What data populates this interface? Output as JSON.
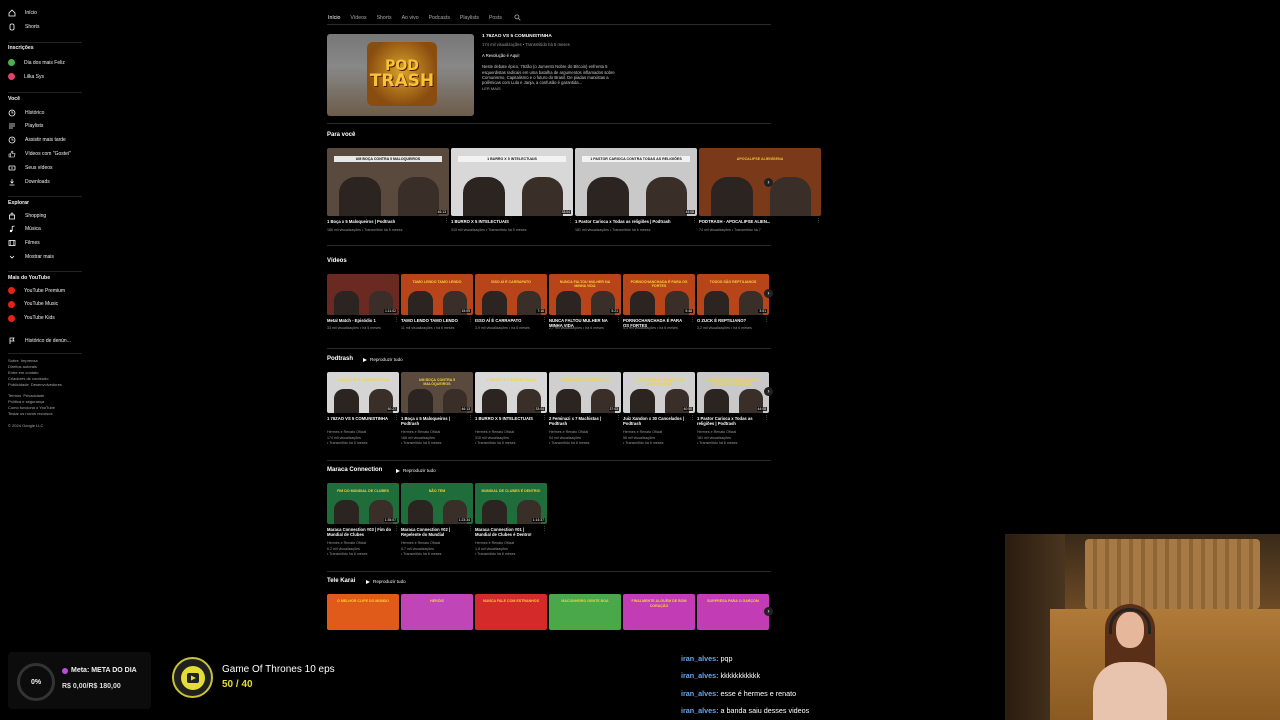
{
  "sidebar": {
    "top": [
      {
        "label": "Início",
        "icon": "home-icon"
      },
      {
        "label": "Shorts",
        "icon": "shorts-icon"
      }
    ],
    "subscriptions_label": "Inscrições",
    "subscriptions": [
      {
        "label": "Dia dos mais Feliz",
        "color": "#4caf50"
      },
      {
        "label": "Lilka Sys",
        "color": "#e0436d"
      }
    ],
    "you_label": "Você",
    "you": [
      {
        "label": "Histórico",
        "icon": "history-icon"
      },
      {
        "label": "Playlists",
        "icon": "playlist-icon"
      },
      {
        "label": "Assistir mais tarde",
        "icon": "clock-icon"
      },
      {
        "label": "Vídeos com \"Gostei\"",
        "icon": "like-icon"
      },
      {
        "label": "Seus vídeos",
        "icon": "video-icon"
      },
      {
        "label": "Downloads",
        "icon": "download-icon"
      }
    ],
    "explore_label": "Explorar",
    "explore": [
      {
        "label": "Shopping",
        "icon": "bag-icon"
      },
      {
        "label": "Música",
        "icon": "music-icon"
      },
      {
        "label": "Filmes",
        "icon": "film-icon"
      },
      {
        "label": "Mostrar mais",
        "icon": "chevron-down-icon"
      }
    ],
    "more_label": "Mais do YouTube",
    "more": [
      {
        "label": "YouTube Premium"
      },
      {
        "label": "YouTube Music"
      },
      {
        "label": "YouTube Kids"
      }
    ],
    "report_label": "Histórico de denún...",
    "footer1": "Sobre  Imprensa\nDireitos autorais\nEntre em contato\nCriadores de conteúdo\nPublicidade  Desenvolvedores",
    "footer2": "Termos  Privacidade\nPolítica e segurança\nComo funciona o YouTube\nTestar os novos recursos",
    "copyright": "© 2024 Google LLC"
  },
  "tabs": [
    "Início",
    "Vídeos",
    "Shorts",
    "Ao vivo",
    "Podcasts",
    "Playlists",
    "Posts"
  ],
  "featured": {
    "logo_line1": "POD",
    "logo_line2": "TRASH",
    "title": "1 76ZAO VS 5 COMUNISTINHA",
    "meta": "174 mil visualizações • Transmitido há 5 meses",
    "subtitle": "A Revolução é Aqui!",
    "description": "Neste debate épico, 76zão (o Jumento Nobre do Bitcoin) enfrenta 5 esquerdistas radicais em uma batalha de argumentos inflamados sobre Comunismo, Capitalismo e o futuro do Brasil. De piadas marxistas a polêmicas com Lula e Janja, a confusão é garantida...",
    "more": "LER MAIS"
  },
  "sections": {
    "for_you": {
      "title": "Para você",
      "items": [
        {
          "caption": "UM BOÇA CONTRA 5 MALOQUEIROS",
          "title": "1 Boça x 5 Maloqueiros | Podtrash",
          "meta": "166 mil visualizações • Transmitido há 5 meses",
          "dur": "46:13",
          "bg": "#5a4a3e",
          "cap_bg": "#e8e8e8",
          "cap_fg": "#111"
        },
        {
          "caption": "1 BURRO X 5 INTELECTUAIS",
          "title": "1 BURRO X 5 INTELECTUAIS",
          "meta": "315 mil visualizações • Transmitido há 5 meses",
          "dur": "33:04",
          "bg": "#d8d8d8",
          "cap_bg": "#f2f2f2",
          "cap_fg": "#111"
        },
        {
          "caption": "1 PASTOR CARIOCA CONTRA TODAS AS RELIGIÕES",
          "title": "1 Pastor Carioca x Todas as religiões | Podtrash",
          "meta": "181 mil visualizações • Transmitido há 6 meses",
          "dur": "44:08",
          "bg": "#c9c9c9",
          "cap_bg": "#f2f2f2",
          "cap_fg": "#111"
        },
        {
          "caption": "APOCALIPSE ALIENÍGENA",
          "title": "PODTRASH - APOCALIPSE ALIEN...",
          "meta": "74 mil visualizações • Transmitido há 7",
          "dur": "",
          "bg": "#7a3a1a",
          "cap_bg": "transparent",
          "cap_fg": "#f5c12f"
        }
      ]
    },
    "videos": {
      "title": "Vídeos",
      "items": [
        {
          "caption": "",
          "title": "Metal Match - Episódio 1",
          "meta": "33 mil visualizações • há 5 meses",
          "dur": "1:11:02",
          "bg": "#6a2a22",
          "cap_bg": "transparent",
          "cap_fg": "#fff"
        },
        {
          "caption": "TAMO LENDO TAMO LENDO",
          "title": "TAMO LENDO TAMO LENDO",
          "meta": "11 mil visualizações • há 6 meses",
          "dur": "15:09",
          "bg": "#b8451a",
          "cap_bg": "transparent",
          "cap_fg": "#f8d23a"
        },
        {
          "caption": "ISSO AÍ É CARRAPATO",
          "title": "ISSO AÍ É CARRAPATO",
          "meta": "3,9 mil visualizações • há 6 meses",
          "dur": "7:16",
          "bg": "#b8451a",
          "cap_bg": "transparent",
          "cap_fg": "#f8d23a"
        },
        {
          "caption": "NUNCA FALTOU MULHER NA MINHA VIDA",
          "title": "NUNCA FALTOU MULHER NA MINHA VIDA",
          "meta": "2,7 mil visualizações • há 6 meses",
          "dur": "5:21",
          "bg": "#b8451a",
          "cap_bg": "transparent",
          "cap_fg": "#f8d23a"
        },
        {
          "caption": "PORNOCHANCHADA É PARA OS FORTES",
          "title": "PORNOCHANCHADA É PARA OS FORTES",
          "meta": "4,3 mil visualizações • há 6 meses",
          "dur": "5:48",
          "bg": "#b8451a",
          "cap_bg": "transparent",
          "cap_fg": "#f8d23a"
        },
        {
          "caption": "TODOS SÃO REPTILIANOS",
          "title": "O ZUCK É REPTILIANO?",
          "meta": "3,2 mil visualizações • há 6 meses",
          "dur": "3:51",
          "bg": "#b8451a",
          "cap_bg": "transparent",
          "cap_fg": "#f8d23a"
        }
      ]
    },
    "podtrash": {
      "title": "Podtrash",
      "play_all": "Reproduzir tudo",
      "items": [
        {
          "caption": "1 76ZAO VS 5 COMUNISTINHA",
          "title": "1 76ZAO VS 5 COMUNISTINHA",
          "channel": "Hermes e Renato Oficial",
          "views": "174 mil visualizações",
          "time": "• Transmitido há 5 meses",
          "dur": "50:27",
          "bg": "#d5d5d5"
        },
        {
          "caption": "UM BOÇA CONTRA 5 MALOQUEIROS",
          "title": "1 Boça x 5 Maloqueiros | Podtrash",
          "channel": "Hermes e Renato Oficial",
          "views": "166 mil visualizações",
          "time": "• Transmitido há 5 meses",
          "dur": "46:13",
          "bg": "#5a4a3e"
        },
        {
          "caption": "1 BURRO X 5 INTELECTUAIS",
          "title": "1 BURRO X 5 INTELECTUAIS",
          "channel": "Hermes e Renato Oficial",
          "views": "315 mil visualizações",
          "time": "• Transmitido há 5 meses",
          "dur": "33:04",
          "bg": "#d8d8d8"
        },
        {
          "caption": "2 FEMINAZI X 7 MACHISTAS",
          "title": "2 Feminazi x 7 Machistas | Podtrash",
          "channel": "Hermes e Renato Oficial",
          "views": "54 mil visualizações",
          "time": "• Transmitido há 6 meses",
          "dur": "37:03",
          "bg": "#cfcfcf"
        },
        {
          "caption": "1 JUIZ XANDÃO CONTRA 30 CANCELADOS",
          "title": "Juiz Xandon x 30 Cancelados | Podtrash",
          "channel": "Hermes e Renato Oficial",
          "views": "56 mil visualizações",
          "time": "• Transmitido há 6 meses",
          "dur": "40:50",
          "bg": "#d0d0d0"
        },
        {
          "caption": "1 PASTOR CARIOCA CONTRA TODAS AS RELIGIÕES",
          "title": "1 Pastor Carioca x Todas as religiões | Podtrash",
          "channel": "Hermes e Renato Oficial",
          "views": "181 mil visualizações",
          "time": "• Transmitido há 6 meses",
          "dur": "44:08",
          "bg": "#c9c9c9"
        }
      ]
    },
    "maraca": {
      "title": "Maraca Connection",
      "play_all": "Reproduzir tudo",
      "items": [
        {
          "caption": "FIM DO MUNDIAL DE CLUBES",
          "title": "Maraca Connection #03 | Fim do Mundial de Clubes",
          "channel": "Hermes e Renato Oficial",
          "views": "6,2 mil visualizações",
          "time": "• Transmitido há 6 meses",
          "dur": "1:35:07",
          "bg": "#1f6d3a"
        },
        {
          "caption": "NÃO TEM",
          "title": "Maraca Connection #02 | Repelente do Mundial",
          "channel": "Hermes e Renato Oficial",
          "views": "5,7 mil visualizações",
          "time": "• Transmitido há 6 meses",
          "dur": "1:23:34",
          "bg": "#1f6d3a"
        },
        {
          "caption": "MUNDIAL DE CLUBES É DENTRO!",
          "title": "Maraca Connection #01 | Mundial de Clubes é Dentro!",
          "channel": "Hermes e Renato Oficial",
          "views": "1,8 mil visualizações",
          "time": "• Transmitido há 6 meses",
          "dur": "1:14:37",
          "bg": "#1f6d3a"
        }
      ]
    },
    "telekarai": {
      "title": "Tele Karai",
      "play_all": "Reproduzir tudo",
      "items": [
        {
          "caption": "O MELHOR CLIPE DO MUNDO",
          "bg": "#e05a1a"
        },
        {
          "caption": "HERÓIS",
          "bg": "#c046b8"
        },
        {
          "caption": "NUNCA FALE COM ESTRANHOS",
          "bg": "#d52a2a"
        },
        {
          "caption": "MACONHEIRO GENTE BOA",
          "bg": "#4aa84a"
        },
        {
          "caption": "FINALMENTE ALGUÉM DE BOM CORAÇÃO",
          "bg": "#c23db5"
        },
        {
          "caption": "SURPRESA PARA O GARÇOM",
          "bg": "#c23db5"
        }
      ]
    }
  },
  "overlay": {
    "goal_percent": "0%",
    "goal_title": "Meta: META DO DIA",
    "goal_value": "R$ 0,00/R$ 180,00",
    "sub_title": "Game Of Thrones 10 eps",
    "sub_progress": "50 / 40"
  },
  "chat": [
    {
      "user": "iran_alves:",
      "msg": " pqp"
    },
    {
      "user": "iran_alves:",
      "msg": " kkkkkkkkkkk"
    },
    {
      "user": "iran_alves:",
      "msg": " esse é hermes e renato"
    },
    {
      "user": "iran_alves:",
      "msg": " a banda saiu desses videos"
    }
  ]
}
